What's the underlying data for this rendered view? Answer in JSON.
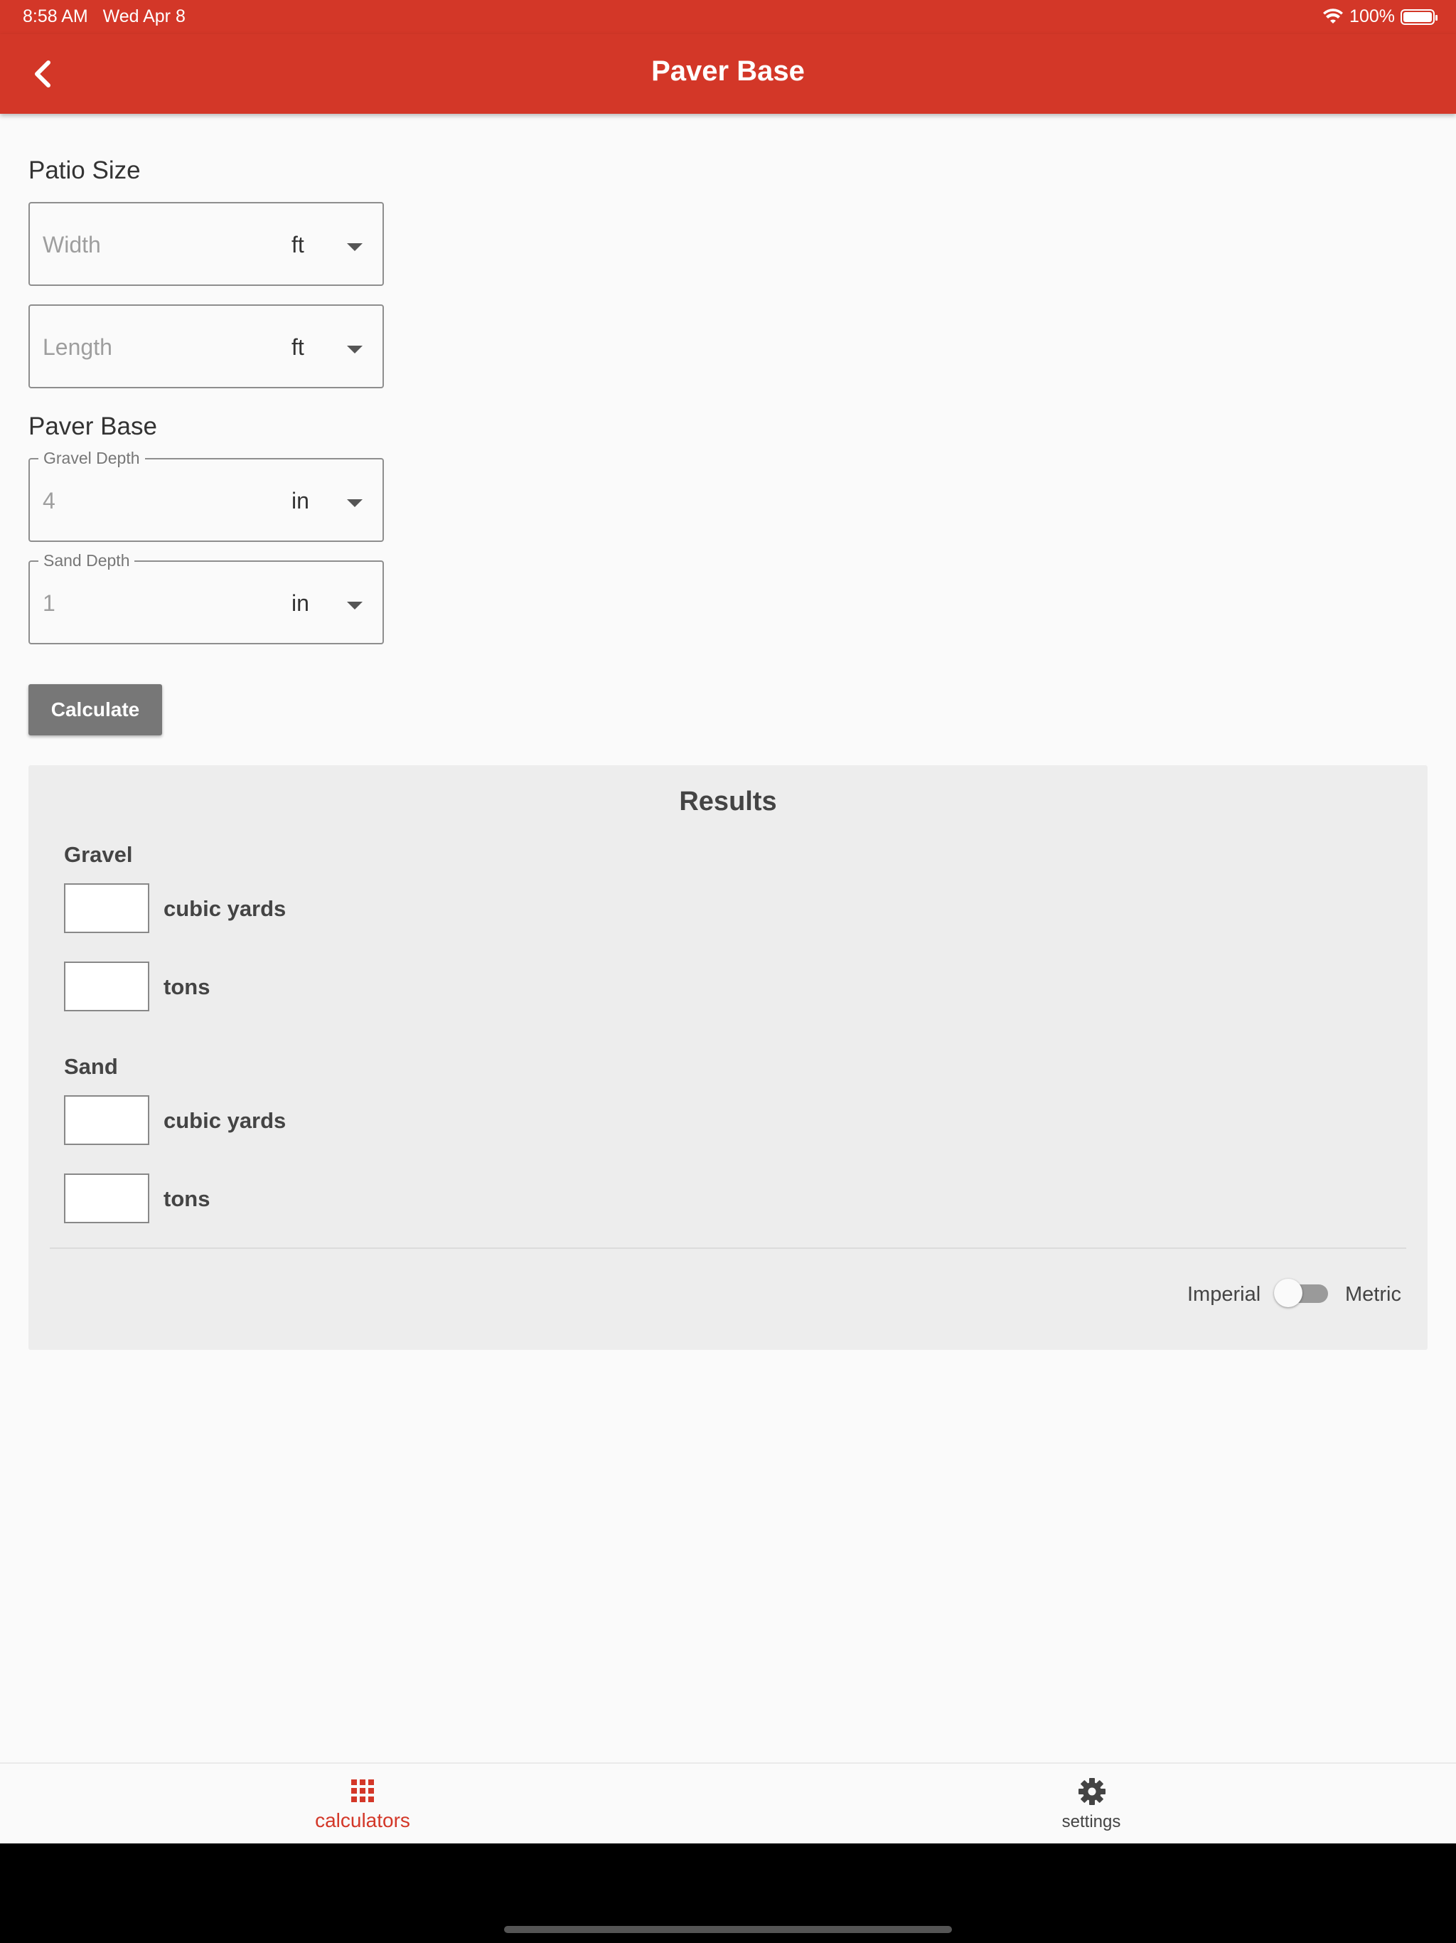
{
  "status_bar": {
    "time": "8:58 AM",
    "date": "Wed Apr 8",
    "battery_percent": "100%"
  },
  "app_bar": {
    "title": "Paver Base",
    "back_icon": "chevron-left-icon"
  },
  "form": {
    "patio_section_label": "Patio Size",
    "width": {
      "placeholder": "Width",
      "value": "",
      "unit": "ft"
    },
    "length": {
      "placeholder": "Length",
      "value": "",
      "unit": "ft"
    },
    "paver_section_label": "Paver Base",
    "gravel_depth": {
      "label": "Gravel Depth",
      "value": "4",
      "unit": "in"
    },
    "sand_depth": {
      "label": "Sand Depth",
      "value": "1",
      "unit": "in"
    },
    "calculate_label": "Calculate"
  },
  "results": {
    "title": "Results",
    "gravel": {
      "label": "Gravel",
      "cubic_yards_value": "",
      "cubic_yards_label": "cubic yards",
      "tons_value": "",
      "tons_label": "tons"
    },
    "sand": {
      "label": "Sand",
      "cubic_yards_value": "",
      "cubic_yards_label": "cubic yards",
      "tons_value": "",
      "tons_label": "tons"
    },
    "units_toggle": {
      "left_label": "Imperial",
      "right_label": "Metric",
      "metric_on": false
    }
  },
  "bottom_nav": {
    "calculators_label": "calculators",
    "calculators_icon": "grid-icon",
    "settings_label": "settings",
    "settings_icon": "gear-icon"
  },
  "colors": {
    "brand": "#d33728",
    "button": "#777777",
    "results_bg": "#ededed"
  }
}
